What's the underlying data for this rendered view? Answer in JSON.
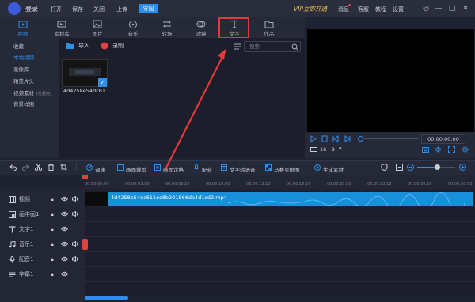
{
  "titlebar": {
    "login": "登录",
    "menu": [
      "打开",
      "保存",
      "关闭",
      "上传"
    ],
    "export": "导出",
    "vip": "VIP立即开通",
    "right_menu": [
      "消息",
      "客服",
      "教程",
      "设置"
    ]
  },
  "tabs": [
    {
      "label": "视频",
      "icon": "video-icon"
    },
    {
      "label": "素材库",
      "icon": "library-icon"
    },
    {
      "label": "图片",
      "icon": "image-icon"
    },
    {
      "label": "音乐",
      "icon": "music-icon"
    },
    {
      "label": "转场",
      "icon": "transition-icon"
    },
    {
      "label": "滤镜",
      "icon": "filter-icon"
    },
    {
      "label": "文字",
      "icon": "text-icon"
    },
    {
      "label": "作品",
      "icon": "folder-icon"
    }
  ],
  "sidebar": {
    "items": [
      {
        "label": "收藏"
      },
      {
        "label": "本地视频"
      },
      {
        "label": "录像库"
      },
      {
        "label": "精美片头"
      },
      {
        "label": "视频素材",
        "tag": "(付费用)"
      },
      {
        "label": "背景样例"
      }
    ]
  },
  "media": {
    "import": "导入",
    "record": "录制",
    "search_placeholder": "搜索",
    "item_title": "4d4258e54dc61..."
  },
  "preview": {
    "time": "00:00:00:00",
    "aspect": "16 : 9"
  },
  "toolbar": {
    "adjust": "调速",
    "crop": "画面裁剪",
    "freeze": "画面定格",
    "dub": "配音",
    "tts": "文字转语音",
    "mosaic": "马赛克框图",
    "generate": "生成素材"
  },
  "ruler": [
    "00:00:00:00",
    "00:00:03:10",
    "00:00:06:20",
    "00:00:10:00",
    "00:00:13:10",
    "00:00:16:20",
    "00:00:20:00",
    "00:00:23:10",
    "00:00:26:20",
    "00:00:30:00"
  ],
  "tracks": [
    "视频",
    "画中画1",
    "文字1",
    "音乐1",
    "配音1",
    "字幕1"
  ],
  "clip_title": "4d4258e54dc611ec8b201866da4d1cd2.mp4",
  "colors": {
    "accent": "#2d8fea",
    "highlight": "#e03a3a",
    "clip": "#1a8fd9",
    "vip": "#f5c14a"
  }
}
